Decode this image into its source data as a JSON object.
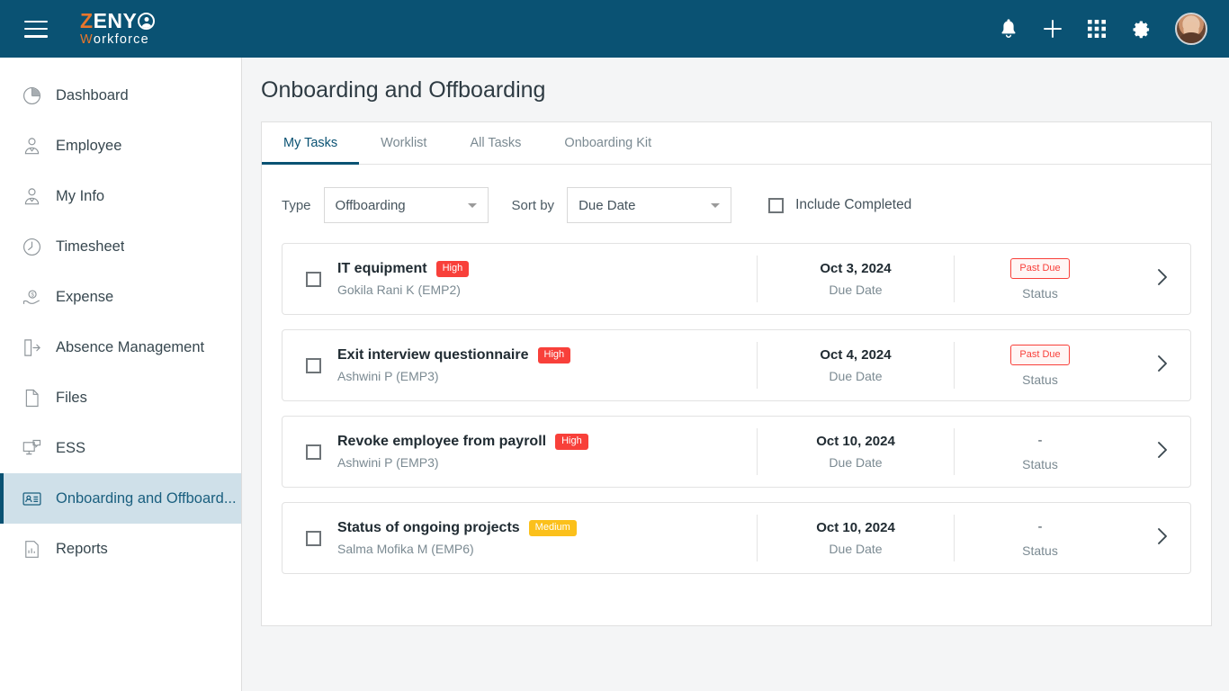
{
  "header": {
    "menu_icon": "hamburger-icon",
    "logo": {
      "part1": "Z",
      "part2": "ENY",
      "part3": "W",
      "part4": "orkforce"
    },
    "icons": [
      {
        "name": "notifications-icon",
        "glyph": "bell"
      },
      {
        "name": "add-icon",
        "glyph": "plus"
      },
      {
        "name": "apps-grid-icon",
        "glyph": "grid"
      },
      {
        "name": "settings-icon",
        "glyph": "gear"
      }
    ],
    "avatar_name": "user-avatar"
  },
  "sidebar": {
    "items": [
      {
        "label": "Dashboard",
        "icon": "pie-chart-icon",
        "active": false
      },
      {
        "label": "Employee",
        "icon": "employee-person-icon",
        "active": false
      },
      {
        "label": "My Info",
        "icon": "my-info-person-icon",
        "active": false
      },
      {
        "label": "Timesheet",
        "icon": "clock-icon",
        "active": false
      },
      {
        "label": "Expense",
        "icon": "money-hand-icon",
        "active": false
      },
      {
        "label": "Absence Management",
        "icon": "door-exit-icon",
        "active": false
      },
      {
        "label": "Files",
        "icon": "file-icon",
        "active": false
      },
      {
        "label": "ESS",
        "icon": "self-service-monitor-icon",
        "active": false
      },
      {
        "label": "Onboarding and Offboard...",
        "icon": "id-card-icon",
        "active": true
      },
      {
        "label": "Reports",
        "icon": "report-chart-icon",
        "active": false
      }
    ]
  },
  "main": {
    "page_title": "Onboarding and Offboarding",
    "tabs": [
      {
        "label": "My Tasks",
        "active": true
      },
      {
        "label": "Worklist",
        "active": false
      },
      {
        "label": "All Tasks",
        "active": false
      },
      {
        "label": "Onboarding Kit",
        "active": false
      }
    ],
    "filters": {
      "type_label": "Type",
      "type_value": "Offboarding",
      "sort_label": "Sort by",
      "sort_value": "Due Date",
      "include_completed_label": "Include Completed",
      "include_completed_checked": false
    },
    "column_labels": {
      "due_date": "Due Date",
      "status": "Status"
    },
    "tasks": [
      {
        "title": "IT equipment",
        "priority": "High",
        "priority_level": "high",
        "employee": "Gokila Rani K (EMP2)",
        "due_date": "Oct 3, 2024",
        "due_date_label": "Due Date",
        "status": "Past Due",
        "status_label": "Status",
        "has_status_badge": true,
        "checked": false
      },
      {
        "title": "Exit interview questionnaire",
        "priority": "High",
        "priority_level": "high",
        "employee": "Ashwini P (EMP3)",
        "due_date": "Oct 4, 2024",
        "due_date_label": "Due Date",
        "status": "Past Due",
        "status_label": "Status",
        "has_status_badge": true,
        "checked": false
      },
      {
        "title": "Revoke employee from payroll",
        "priority": "High",
        "priority_level": "high",
        "employee": "Ashwini P (EMP3)",
        "due_date": "Oct 10, 2024",
        "due_date_label": "Due Date",
        "status": "-",
        "status_label": "Status",
        "has_status_badge": false,
        "checked": false
      },
      {
        "title": "Status of ongoing projects",
        "priority": "Medium",
        "priority_level": "medium",
        "employee": "Salma Mofika M (EMP6)",
        "due_date": "Oct 10, 2024",
        "due_date_label": "Due Date",
        "status": "-",
        "status_label": "Status",
        "has_status_badge": false,
        "checked": false
      }
    ]
  },
  "colors": {
    "brand_dark": "#0a5273",
    "brand_orange": "#e8762c",
    "active_nav_bg": "#cfe0e9",
    "priority_high": "#f8403a",
    "priority_medium": "#fbc01b",
    "status_past_due": "#f8403a",
    "page_bg": "#f4f5f6"
  }
}
